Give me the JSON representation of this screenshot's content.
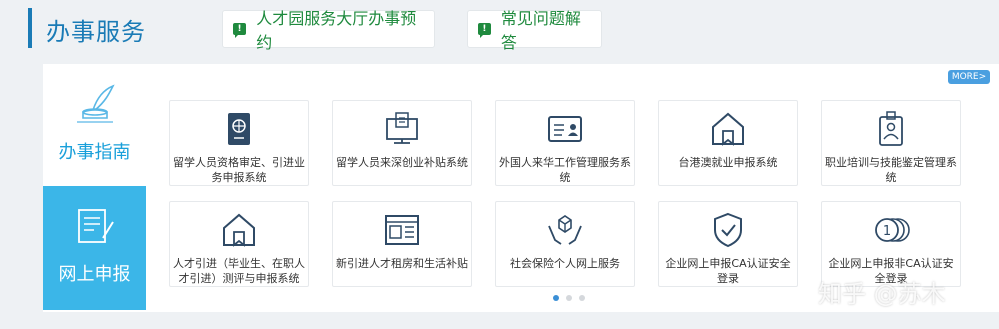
{
  "header": {
    "title": "办事服务",
    "buttons": [
      {
        "label": "人才园服务大厅办事预约"
      },
      {
        "label": "常见问题解答"
      }
    ]
  },
  "panel": {
    "more_label": "MORE>",
    "side_tabs": [
      {
        "label": "办事指南",
        "active": false
      },
      {
        "label": "网上申报",
        "active": true
      }
    ],
    "services": [
      {
        "label": "留学人员资格审定、引进业务申报系统",
        "icon": "passport-icon"
      },
      {
        "label": "留学人员来深创业补贴系统",
        "icon": "computer-certificate-icon"
      },
      {
        "label": "外国人来华工作管理服务系统",
        "icon": "id-card-icon"
      },
      {
        "label": "台港澳就业申报系统",
        "icon": "house-icon"
      },
      {
        "label": "职业培训与技能鉴定管理系统",
        "icon": "badge-icon"
      },
      {
        "label": "人才引进（毕业生、在职人才引进）测评与申报系统",
        "icon": "house-icon"
      },
      {
        "label": "新引进人才租房和生活补贴",
        "icon": "newspaper-icon"
      },
      {
        "label": "社会保险个人网上服务",
        "icon": "hands-box-icon"
      },
      {
        "label": "企业网上申报CA认证安全登录",
        "icon": "shield-check-icon"
      },
      {
        "label": "企业网上申报非CA认证安全登录",
        "icon": "coin-stack-icon"
      }
    ],
    "pagination": {
      "count": 3,
      "active": 1
    }
  },
  "watermark": "知乎 @苏木",
  "colors": {
    "accent": "#1a7bb6",
    "green": "#1f8a3e",
    "active_tab": "#3bb6e8",
    "icon": "#2f4a66"
  }
}
